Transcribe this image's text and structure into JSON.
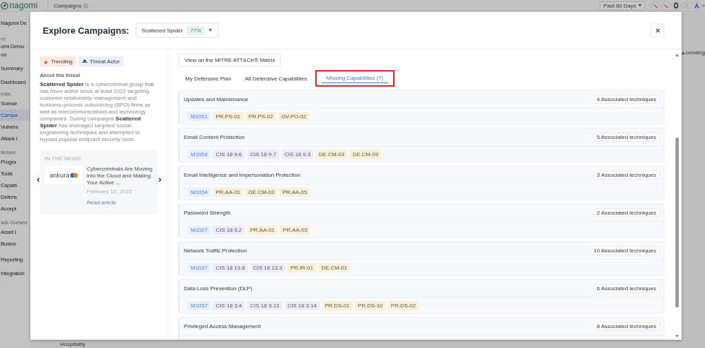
{
  "app": {
    "logo": "nagomi",
    "page_title": "Campaigns",
    "date_range": "Past 60 Days",
    "sidebar": [
      {
        "label": "Nagomi De",
        "kind": "org",
        "selected": false
      },
      {
        "label": "nt",
        "kind": "caption",
        "selected": false
      },
      {
        "label": "omi Demo",
        "kind": "org",
        "selected": false
      },
      {
        "label": "on",
        "kind": "org",
        "selected": false
      },
      {
        "label": "Summary",
        "kind": "link",
        "selected": false
      },
      {
        "label": "Dashboard",
        "kind": "link",
        "selected": false
      },
      {
        "label": "eats",
        "kind": "section",
        "selected": false
      },
      {
        "label": "Scenar",
        "kind": "item",
        "selected": false
      },
      {
        "label": "Campa",
        "kind": "item",
        "selected": true
      },
      {
        "label": "Vulnera",
        "kind": "item",
        "selected": false
      },
      {
        "label": "Attack I",
        "kind": "item",
        "selected": false
      },
      {
        "label": "fenses",
        "kind": "section",
        "selected": false
      },
      {
        "label": "Progra",
        "kind": "item",
        "selected": false
      },
      {
        "label": "Tools",
        "kind": "item",
        "selected": false
      },
      {
        "label": "Capabi",
        "kind": "item",
        "selected": false
      },
      {
        "label": "Defens",
        "kind": "item",
        "selected": false
      },
      {
        "label": "Accept",
        "kind": "item",
        "selected": false
      },
      {
        "label": "ack Surface",
        "kind": "section",
        "selected": false
      },
      {
        "label": "Asset I",
        "kind": "item",
        "selected": false
      },
      {
        "label": "Busine",
        "kind": "item",
        "selected": false
      },
      {
        "label": "Reporting",
        "kind": "link",
        "selected": false
      },
      {
        "label": "Integration",
        "kind": "link",
        "selected": false
      }
    ],
    "sort_label": "cending",
    "table_cell": "Hospitality"
  },
  "modal": {
    "title": "Explore Campaigns:",
    "campaign": {
      "name": "Scattered Spider",
      "score": "77%"
    },
    "labels": [
      {
        "text": "Trending",
        "kind": "trending"
      },
      {
        "text": "Threat Actor",
        "kind": "actor"
      }
    ],
    "about_heading": "About this threat",
    "about_text": "**Scattered Spider** is a cybercriminal group that has been active since at least 2022 targeting customer relationship management and business-process outsourcing (BPO) firms as well as telecommunications and technology companies. During campaigns **Scattered Spider** has leveraged targeted social-engineering techniques and attempted to bypass popular endpoint security tools.",
    "news": {
      "heading": "IN THE NEWS",
      "source": "ankura",
      "headline": "Cybercriminals Are Moving into the Cloud and Making Your Active ...",
      "date": "February 10, 2025",
      "link": "Read article"
    },
    "matrix_button": "View on the MITRE ATT&CK® Matrix",
    "tabs": [
      {
        "label": "My Defensive Plan",
        "selected": false,
        "highlighted": false
      },
      {
        "label": "All Defensive Capabilities",
        "selected": false,
        "highlighted": false
      },
      {
        "label": "Missing Capabilities (7)",
        "selected": true,
        "highlighted": true
      }
    ],
    "capabilities": [
      {
        "title": "Updates and Maintenance",
        "count": "4 Associated techniques",
        "tags": [
          {
            "text": "M1051",
            "kind": "mitigation"
          },
          {
            "text": "PR.PS-01",
            "kind": "nist"
          },
          {
            "text": "PR.PS-02",
            "kind": "nist"
          },
          {
            "text": "GV.PO-02",
            "kind": "nist"
          }
        ]
      },
      {
        "title": "Email Content Protection",
        "count": "5 Associated techniques",
        "tags": [
          {
            "text": "M1054",
            "kind": "mitigation"
          },
          {
            "text": "CIS 18 9.6",
            "kind": "cis"
          },
          {
            "text": "CIS 18 9.7",
            "kind": "cis"
          },
          {
            "text": "CIS 18 9.3",
            "kind": "cis"
          },
          {
            "text": "DE.CM-03",
            "kind": "nist"
          },
          {
            "text": "DE.CM-09",
            "kind": "nist"
          }
        ]
      },
      {
        "title": "Email Intelligence and Impersonation Protection",
        "count": "3 Associated techniques",
        "tags": [
          {
            "text": "M1054",
            "kind": "mitigation"
          },
          {
            "text": "PR.AA-01",
            "kind": "nist"
          },
          {
            "text": "DE.CM-03",
            "kind": "nist"
          },
          {
            "text": "PR.AA-05",
            "kind": "nist"
          }
        ]
      },
      {
        "title": "Password Strength",
        "count": "2 Associated techniques",
        "tags": [
          {
            "text": "M1027",
            "kind": "mitigation"
          },
          {
            "text": "CIS 18 5.2",
            "kind": "cis"
          },
          {
            "text": "PR.AA-01",
            "kind": "nist"
          },
          {
            "text": "PR.AA-03",
            "kind": "nist"
          }
        ]
      },
      {
        "title": "Network Traffic Protection",
        "count": "10 Associated techniques",
        "tags": [
          {
            "text": "M1037",
            "kind": "mitigation"
          },
          {
            "text": "CIS 18 13.8",
            "kind": "cis"
          },
          {
            "text": "CIS 18 13.3",
            "kind": "cis"
          },
          {
            "text": "PR.IR-01",
            "kind": "nist"
          },
          {
            "text": "DE.CM-01",
            "kind": "nist"
          }
        ]
      },
      {
        "title": "Data Loss Prevention (DLP)",
        "count": "6 Associated techniques",
        "tags": [
          {
            "text": "M1057",
            "kind": "mitigation"
          },
          {
            "text": "CIS 18 3.4",
            "kind": "cis"
          },
          {
            "text": "CIS 18 3.13",
            "kind": "cis"
          },
          {
            "text": "CIS 18 3.14",
            "kind": "cis"
          },
          {
            "text": "PR.DS-01",
            "kind": "nist"
          },
          {
            "text": "PR.DS-10",
            "kind": "nist"
          },
          {
            "text": "PR.DS-02",
            "kind": "nist"
          }
        ]
      },
      {
        "title": "Privileged Access Management",
        "count": "8 Associated techniques"
      }
    ]
  }
}
